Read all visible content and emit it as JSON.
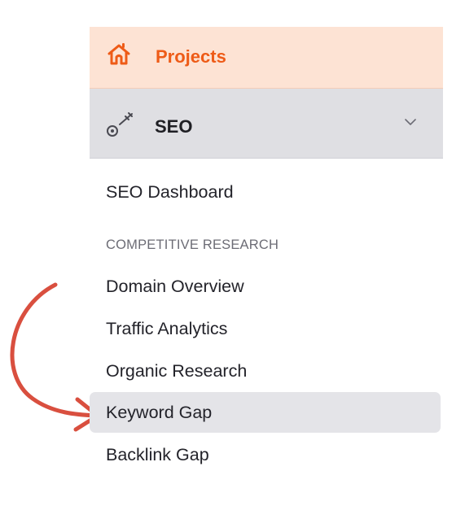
{
  "nav": {
    "projects": {
      "label": "Projects",
      "icon": "home-icon",
      "color": "#ee5b17",
      "background": "#fde3d4"
    },
    "seo": {
      "label": "SEO",
      "icon": "key-icon",
      "expand_icon": "chevron-down-icon",
      "background": "#dfdfe3"
    },
    "items": {
      "seo_dashboard": "SEO Dashboard",
      "section_heading": "COMPETITIVE RESEARCH",
      "domain_overview": "Domain Overview",
      "traffic_analytics": "Traffic Analytics",
      "organic_research": "Organic Research",
      "keyword_gap": "Keyword Gap",
      "backlink_gap": "Backlink Gap"
    },
    "selected_item": "Keyword Gap"
  },
  "annotation": {
    "icon": "curved-arrow-icon",
    "color": "#d94f3f"
  }
}
